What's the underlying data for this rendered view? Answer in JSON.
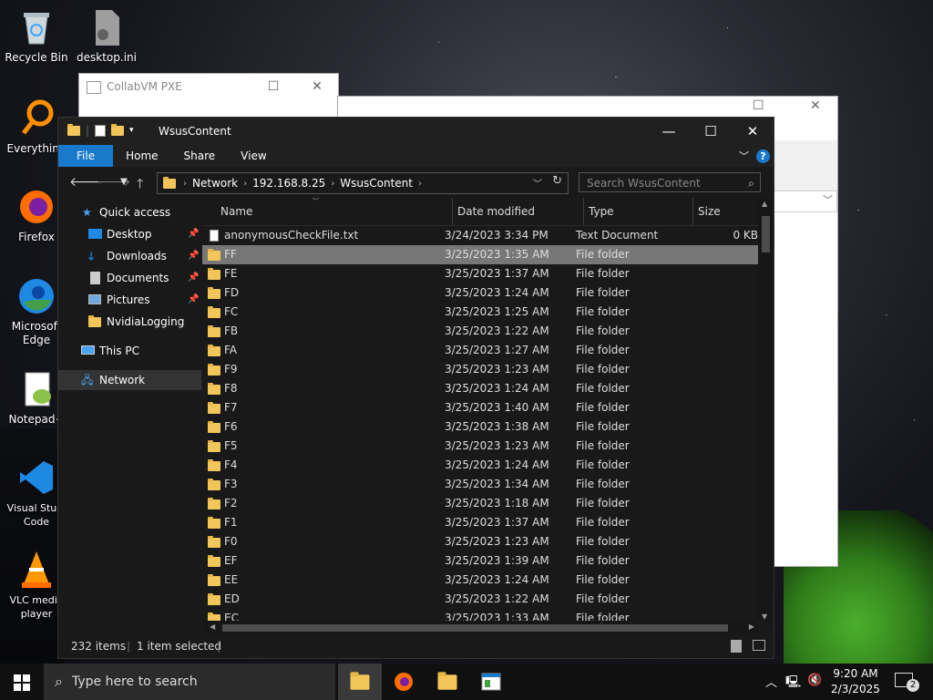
{
  "desktop": {
    "icons": [
      {
        "label": "Recycle Bin",
        "icon": "recycle-bin-icon"
      },
      {
        "label": "desktop.ini",
        "icon": "ini-file-icon"
      },
      {
        "label": "Everything",
        "icon": "everything-icon"
      },
      {
        "label": "Firefox",
        "icon": "firefox-icon"
      },
      {
        "label": "Microsoft Edge",
        "icon": "edge-icon"
      },
      {
        "label": "Notepad+",
        "icon": "notepadpp-icon"
      },
      {
        "label": "Visual Studi Code",
        "icon": "vscode-icon"
      },
      {
        "label": "VLC media player",
        "icon": "vlc-icon"
      }
    ]
  },
  "bg_window": {
    "title": "CollabVM PXE"
  },
  "explorer": {
    "title": "WsusContent",
    "ribbon_tabs": [
      "File",
      "Home",
      "Share",
      "View"
    ],
    "breadcrumb": [
      "Network",
      "192.168.8.25",
      "WsusContent"
    ],
    "search_placeholder": "Search WsusContent",
    "columns": [
      "Name",
      "Date modified",
      "Type",
      "Size"
    ],
    "nav": [
      {
        "label": "Quick access",
        "icon": "star-icon"
      },
      {
        "label": "Desktop",
        "icon": "desktop-icon"
      },
      {
        "label": "Downloads",
        "icon": "download-icon"
      },
      {
        "label": "Documents",
        "icon": "documents-icon"
      },
      {
        "label": "Pictures",
        "icon": "pictures-icon"
      },
      {
        "label": "NvidiaLogging",
        "icon": "folder-icon"
      },
      {
        "label": "This PC",
        "icon": "computer-icon"
      },
      {
        "label": "Network",
        "icon": "network-icon"
      }
    ],
    "files": [
      {
        "name": "anonymousCheckFile.txt",
        "date": "3/24/2023 3:34 PM",
        "type": "Text Document",
        "size": "0 KB"
      },
      {
        "name": "FF",
        "date": "3/25/2023 1:35 AM",
        "type": "File folder",
        "size": ""
      },
      {
        "name": "FE",
        "date": "3/25/2023 1:37 AM",
        "type": "File folder",
        "size": ""
      },
      {
        "name": "FD",
        "date": "3/25/2023 1:24 AM",
        "type": "File folder",
        "size": ""
      },
      {
        "name": "FC",
        "date": "3/25/2023 1:25 AM",
        "type": "File folder",
        "size": ""
      },
      {
        "name": "FB",
        "date": "3/25/2023 1:22 AM",
        "type": "File folder",
        "size": ""
      },
      {
        "name": "FA",
        "date": "3/25/2023 1:27 AM",
        "type": "File folder",
        "size": ""
      },
      {
        "name": "F9",
        "date": "3/25/2023 1:23 AM",
        "type": "File folder",
        "size": ""
      },
      {
        "name": "F8",
        "date": "3/25/2023 1:24 AM",
        "type": "File folder",
        "size": ""
      },
      {
        "name": "F7",
        "date": "3/25/2023 1:40 AM",
        "type": "File folder",
        "size": ""
      },
      {
        "name": "F6",
        "date": "3/25/2023 1:38 AM",
        "type": "File folder",
        "size": ""
      },
      {
        "name": "F5",
        "date": "3/25/2023 1:23 AM",
        "type": "File folder",
        "size": ""
      },
      {
        "name": "F4",
        "date": "3/25/2023 1:24 AM",
        "type": "File folder",
        "size": ""
      },
      {
        "name": "F3",
        "date": "3/25/2023 1:34 AM",
        "type": "File folder",
        "size": ""
      },
      {
        "name": "F2",
        "date": "3/25/2023 1:18 AM",
        "type": "File folder",
        "size": ""
      },
      {
        "name": "F1",
        "date": "3/25/2023 1:37 AM",
        "type": "File folder",
        "size": ""
      },
      {
        "name": "F0",
        "date": "3/25/2023 1:23 AM",
        "type": "File folder",
        "size": ""
      },
      {
        "name": "EF",
        "date": "3/25/2023 1:39 AM",
        "type": "File folder",
        "size": ""
      },
      {
        "name": "EE",
        "date": "3/25/2023 1:24 AM",
        "type": "File folder",
        "size": ""
      },
      {
        "name": "ED",
        "date": "3/25/2023 1:22 AM",
        "type": "File folder",
        "size": ""
      },
      {
        "name": "EC",
        "date": "3/25/2023 1:33 AM",
        "type": "File folder",
        "size": ""
      }
    ],
    "selected_index": 1,
    "status_count": "232 items",
    "status_selection": "1 item selected"
  },
  "taskbar": {
    "search_placeholder": "Type here to search",
    "time": "9:20 AM",
    "date": "2/3/2025",
    "notification_count": "2"
  }
}
